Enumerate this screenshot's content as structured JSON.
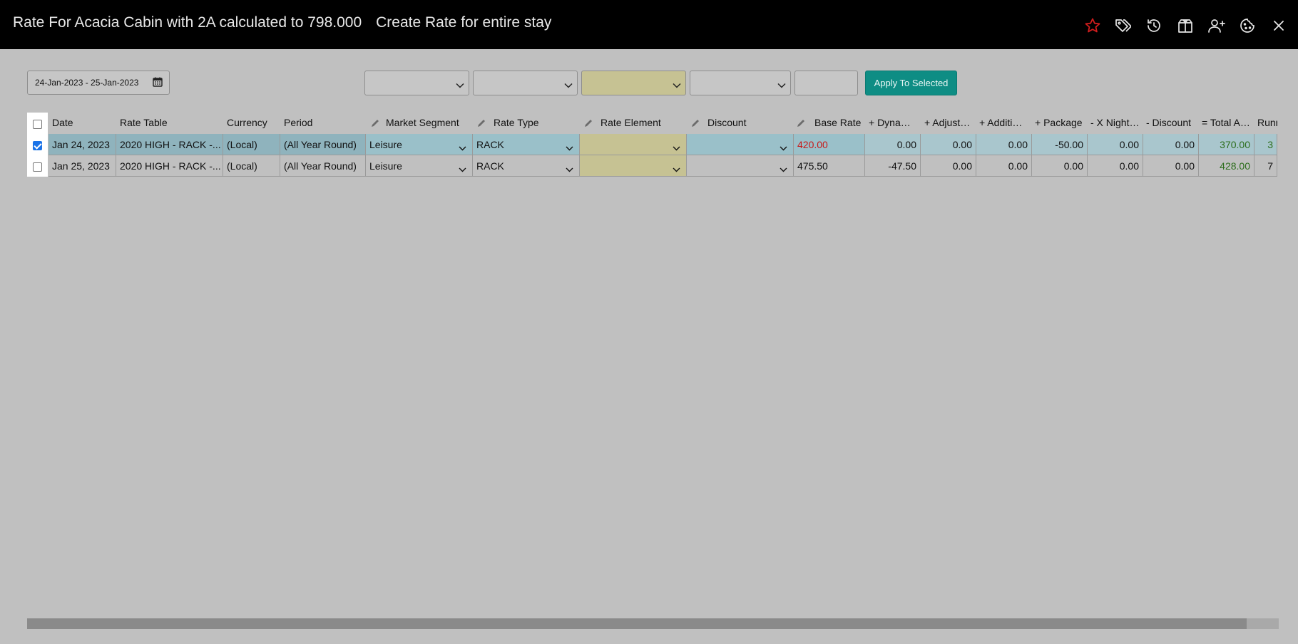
{
  "window": {
    "title": "Rate For Acacia Cabin with 2A calculated to 798.000",
    "subtitle": "Create Rate for entire stay"
  },
  "icons": [
    "star-icon",
    "tags-icon",
    "history-icon",
    "package-icon",
    "add-guest-icon",
    "cookie-icon",
    "close-icon"
  ],
  "colors": {
    "accent": "#0e8d84",
    "favorite": "#d11d1d",
    "selected_row": "#8fb3bd",
    "yellow_field": "#c6c293"
  },
  "toolbar": {
    "date_range": "24-Jan-2023 - 25-Jan-2023",
    "apply_label": "Apply To Selected"
  },
  "columns": {
    "date": "Date",
    "rate_table": "Rate Table",
    "currency": "Currency",
    "period": "Period",
    "market_segment": "Market Segment",
    "rate_type": "Rate Type",
    "rate_element": "Rate Element",
    "discount": "Discount",
    "base_rate": "Base Rate",
    "dynamic": "+ Dyna…",
    "adjust": "+ Adjust…",
    "additional": "+ Additi…",
    "package": "+ Package",
    "x_nights": "- X Night…",
    "discount_amt": "- Discount",
    "total": "= Total A…",
    "running": "Runn"
  },
  "rows": [
    {
      "checked": true,
      "date": "Jan 24, 2023",
      "rate_table": "2020 HIGH - RACK -...",
      "currency": "(Local)",
      "period": "(All Year Round)",
      "market_segment": "Leisure",
      "rate_type": "RACK",
      "rate_element": "",
      "discount": "",
      "base_rate": "420.00",
      "dynamic": "0.00",
      "adjust": "0.00",
      "additional": "0.00",
      "package": "-50.00",
      "x_nights": "0.00",
      "discount_amt": "0.00",
      "total": "370.00",
      "running": "3"
    },
    {
      "checked": false,
      "date": "Jan 25, 2023",
      "rate_table": "2020 HIGH - RACK -...",
      "currency": "(Local)",
      "period": "(All Year Round)",
      "market_segment": "Leisure",
      "rate_type": "RACK",
      "rate_element": "",
      "discount": "",
      "base_rate": "475.50",
      "dynamic": "-47.50",
      "adjust": "0.00",
      "additional": "0.00",
      "package": "0.00",
      "x_nights": "0.00",
      "discount_amt": "0.00",
      "total": "428.00",
      "running": "7"
    }
  ]
}
